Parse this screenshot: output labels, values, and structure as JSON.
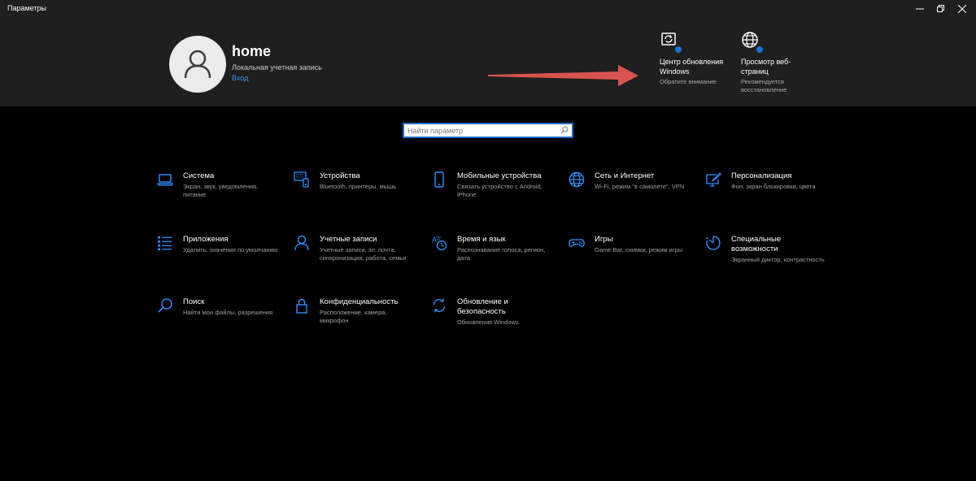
{
  "window": {
    "title": "Параметры"
  },
  "account": {
    "name": "home",
    "type": "Локальная учетная запись",
    "signin_link": "Вход"
  },
  "quick_actions": [
    {
      "title": "Центр обновления Windows",
      "subtitle": "Обратите внимание",
      "icon": "windows-update-icon"
    },
    {
      "title": "Просмотр веб-страниц",
      "subtitle": "Рекомендуется восстановление",
      "icon": "globe-icon"
    }
  ],
  "search": {
    "placeholder": "Найти параметр"
  },
  "categories": [
    {
      "title": "Система",
      "desc": "Экран, звук, уведомления, питание",
      "icon": "laptop-icon"
    },
    {
      "title": "Устройства",
      "desc": "Bluetooth, принтеры, мышь",
      "icon": "keyboard-devices-icon"
    },
    {
      "title": "Мобильные устройства",
      "desc": "Связать устройство с Android, iPhone",
      "icon": "phone-icon"
    },
    {
      "title": "Сеть и Интернет",
      "desc": "Wi-Fi, режим \"в самолете\", VPN",
      "icon": "globe-icon"
    },
    {
      "title": "Персонализация",
      "desc": "Фон, экран блокировки, цвета",
      "icon": "paint-icon"
    },
    {
      "title": "Приложения",
      "desc": "Удалить, значения по умолчанию",
      "icon": "apps-list-icon"
    },
    {
      "title": "Учетные записи",
      "desc": "Учетные записи, эл. почта, синхронизация, работа, семья",
      "icon": "person-icon"
    },
    {
      "title": "Время и язык",
      "desc": "Распознавание голоса, регион, дата",
      "icon": "time-language-icon"
    },
    {
      "title": "Игры",
      "desc": "Game Bar, снимки, режим игры",
      "icon": "gamepad-icon"
    },
    {
      "title": "Специальные возможности",
      "desc": "Экранный диктор, контрастность",
      "icon": "accessibility-icon"
    },
    {
      "title": "Поиск",
      "desc": "Найти мои файлы, разрешения",
      "icon": "search-icon"
    },
    {
      "title": "Конфиденциальность",
      "desc": "Расположение, камера, микрофон",
      "icon": "lock-icon"
    },
    {
      "title": "Обновление и безопасность",
      "desc": "Обновления Windows",
      "icon": "update-sync-icon"
    }
  ],
  "colors": {
    "accent": "#1674d6",
    "icon_blue": "#2f8fff",
    "header_bg": "#1f1f1f",
    "arrow": "#d9534f"
  }
}
